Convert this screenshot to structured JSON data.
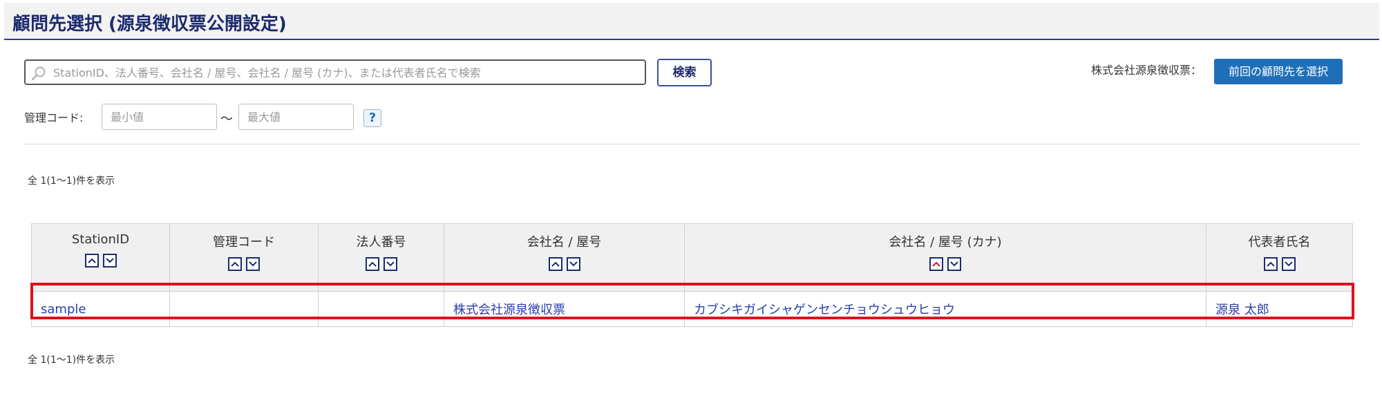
{
  "header": {
    "title": "顧問先選択 (源泉徴収票公開設定)"
  },
  "search": {
    "placeholder": "StationID、法人番号、会社名 / 屋号、会社名 / 屋号 (カナ)、または代表者氏名で検索",
    "value": "",
    "button_label": "検索"
  },
  "previous": {
    "company_label": "株式会社源泉徴収票：",
    "button_label": "前回の顧問先を選択"
  },
  "management_code": {
    "label": "管理コード:",
    "min_placeholder": "最小値",
    "max_placeholder": "最大値",
    "separator": "～",
    "help_label": "?"
  },
  "result_count": {
    "top": "全 1(1～1)件を表示",
    "bottom": "全 1(1～1)件を表示"
  },
  "table": {
    "columns": [
      {
        "label": "StationID"
      },
      {
        "label": "管理コード"
      },
      {
        "label": "法人番号"
      },
      {
        "label": "会社名 / 屋号"
      },
      {
        "label": "会社名 / 屋号 (カナ)"
      },
      {
        "label": "代表者氏名"
      }
    ],
    "rows": [
      {
        "station_id": "sample",
        "management_code": "",
        "corporate_number": "",
        "company_name": "株式会社源泉徴収票",
        "company_kana": "カブシキガイシャゲンセンチョウシュウヒョウ",
        "representative": "源泉 太郎"
      }
    ]
  },
  "colors": {
    "title": "#1c2a6e",
    "primary_button": "#1f6fb8",
    "link": "#2a3ea8",
    "highlight": "#e0101b",
    "active_sort": "#e0101b"
  },
  "icons": {
    "search": "search-icon",
    "sort_asc": "sort-ascending-icon",
    "sort_desc": "sort-descending-icon"
  }
}
